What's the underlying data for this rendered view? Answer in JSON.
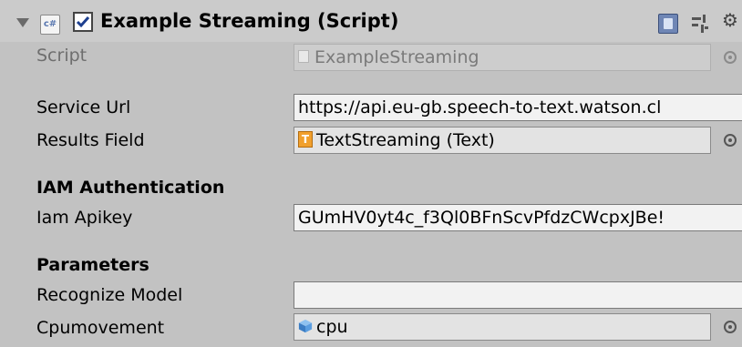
{
  "component": {
    "title": "Example Streaming (Script)",
    "enabled": true,
    "icons": [
      "foldout-arrow-icon",
      "csharp-script-icon",
      "enabled-checkbox",
      "help-icon",
      "presets-icon",
      "gear-icon"
    ]
  },
  "script": {
    "label": "Script",
    "value": "ExampleStreaming"
  },
  "service_url": {
    "label": "Service Url",
    "value": "https://api.eu-gb.speech-to-text.watson.cl"
  },
  "results_field": {
    "label": "Results Field",
    "value": "TextStreaming (Text)",
    "icon_letter": "T"
  },
  "iam_section": {
    "header": "IAM Authentication",
    "apikey_label": "Iam Apikey",
    "apikey_value": "GUmHV0yt4c_f3Ql0BFnScvPfdzCWcpxJBe!"
  },
  "parameters_section": {
    "header": "Parameters",
    "recognize_model_label": "Recognize Model",
    "recognize_model_value": "",
    "cpumovement_label": "Cpumovement",
    "cpumovement_value": "cpu"
  },
  "colors": {
    "background": "#c2c2c2",
    "header": "#cbcbcb",
    "text_field": "#f2f2f2",
    "object_field": "#e3e3e3",
    "text_icon": "#f1a02d",
    "prefab_icon": "#4a90d9"
  }
}
